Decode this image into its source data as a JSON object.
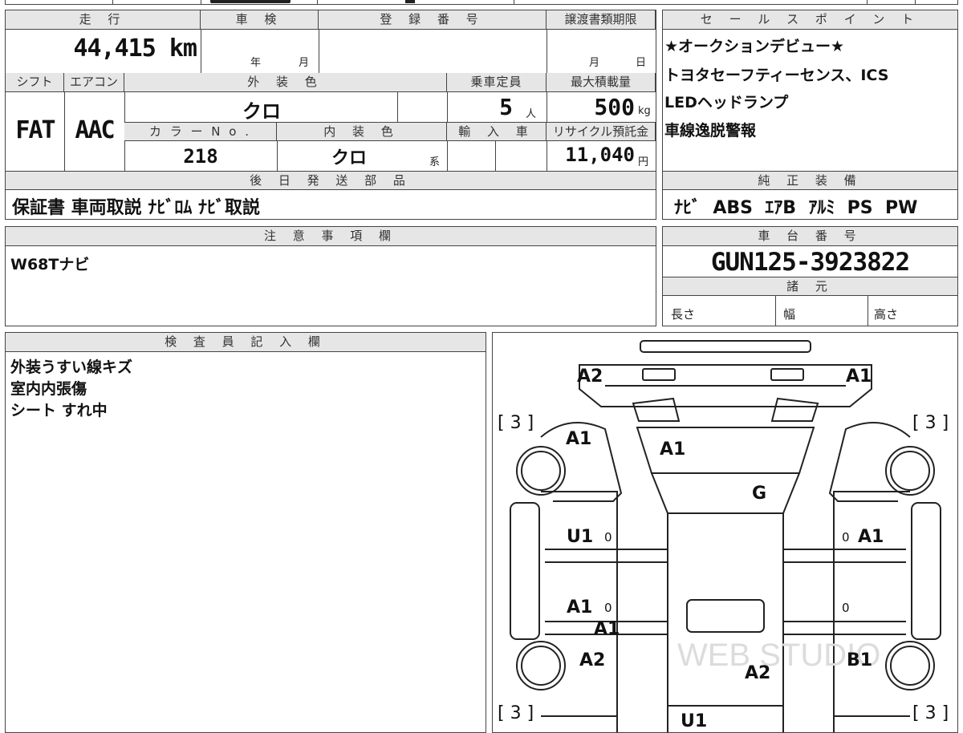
{
  "top_strip": {
    "glyph_a": "",
    "glyph_b": ""
  },
  "header": {
    "mileage_label": "走 行",
    "mileage_value": "44,415 km",
    "inspection_label": "車 検",
    "inspection_year": "年",
    "inspection_month": "月",
    "registration_label": "登 録 番 号",
    "transfer_label": "譲渡書類期限",
    "transfer_month": "月",
    "transfer_day": "日",
    "shift_label": "シフト",
    "shift_value": "FAT",
    "aircon_label": "エアコン",
    "aircon_value": "AAC",
    "exterior_label": "外 装 色",
    "exterior_value": "クロ",
    "capacity_label": "乗車定員",
    "capacity_value": "5",
    "capacity_unit": "人",
    "maxload_label": "最大積載量",
    "maxload_value": "500",
    "maxload_unit": "kg",
    "colorno_label": "カ ラ ー N o .",
    "colorno_value": "218",
    "interior_label": "内 装 色",
    "interior_value": "クロ",
    "interior_unit": "系",
    "import_label": "輸 入 車",
    "recycle_label": "リサイクル預託金",
    "recycle_value": "11,040",
    "recycle_unit": "円",
    "later_label": "後 日 発 送 部 品",
    "later_value": "保証書 車両取説 ﾅﾋﾞﾛﾑ ﾅﾋﾞ取説"
  },
  "sales": {
    "label": "セ ー ル ス ポ イ ン ト",
    "lines": [
      "★オークションデビュー★",
      "トヨタセーフティーセンス、ICS",
      "LEDヘッドランプ",
      "車線逸脱警報"
    ]
  },
  "genuine": {
    "label": "純 正 装 備",
    "value": "ﾅﾋﾞ  ABS  ｴｱB  ｱﾙﾐ  PS  PW"
  },
  "notes": {
    "label": "注 意 事 項 欄",
    "value": "W68Tナビ"
  },
  "chassis": {
    "label": "車 台 番 号",
    "value": "GUN125-3923822",
    "specs_label": "諸 元",
    "length_label": "長さ",
    "width_label": "幅",
    "height_label": "高さ"
  },
  "inspector": {
    "label": "検 査 員 記 入 欄",
    "lines": [
      "外装うすい線キズ",
      "室内内張傷",
      "シート すれ中"
    ]
  },
  "diagram": {
    "watermark": "WEB STUDIO",
    "marks": {
      "front_left": "A2",
      "front_right": "A1",
      "bracket_tl": "[ 3 ]",
      "bracket_tr": "[ 3 ]",
      "bracket_bl": "[ 3 ]",
      "bracket_br": "[ 3 ]",
      "fender_left": "A1",
      "windshield": "A1",
      "hood": "G",
      "door_lf": "U1",
      "door_lf_small": "0",
      "door_rf": "A1",
      "door_rf_small": "0",
      "door_lr": "A1",
      "door_lr_small": "0",
      "door_rr_small": "0",
      "sill_left": "A1",
      "quarter_left": "A2",
      "roof": "A2",
      "quarter_right": "B1",
      "rear": "U1"
    }
  }
}
